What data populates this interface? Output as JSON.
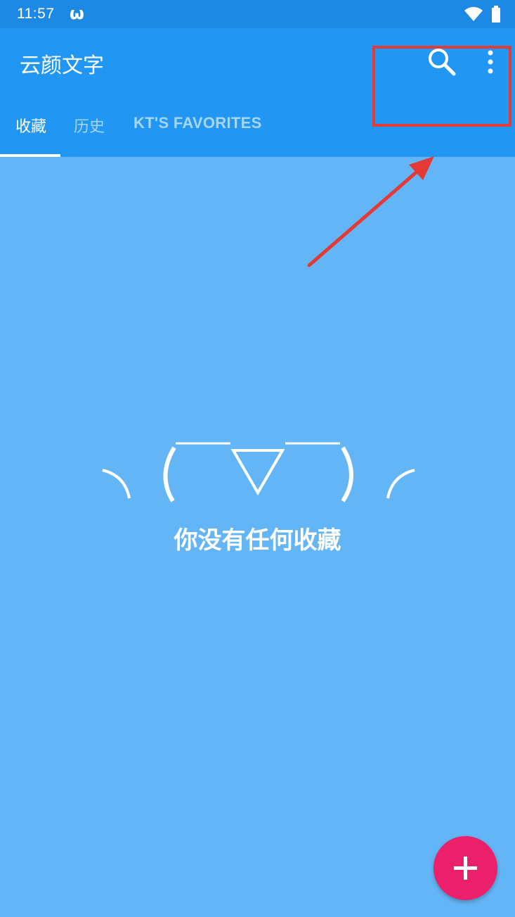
{
  "status_bar": {
    "time": "11:57",
    "app_icon_glyph": "ω",
    "icons": [
      "wifi-icon",
      "battery-icon"
    ]
  },
  "app_bar": {
    "title": "云颜文字",
    "actions": [
      "search-icon",
      "more-vert-icon"
    ]
  },
  "tabs": [
    {
      "label": "收藏",
      "selected": true
    },
    {
      "label": "历史",
      "selected": false
    },
    {
      "label": "KT'S FAVORITES",
      "selected": false
    }
  ],
  "empty_state": {
    "message": "你没有任何收藏"
  },
  "fab": {
    "icon": "plus-icon"
  },
  "annotation": {
    "highlight_color": "#E53935"
  },
  "colors": {
    "status_bar": "#1E88E5",
    "app_bar": "#2196F3",
    "background": "#64B5F6",
    "fab": "#EC1F6B"
  }
}
